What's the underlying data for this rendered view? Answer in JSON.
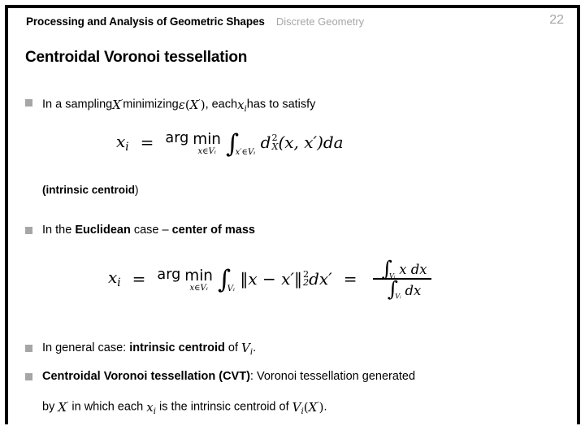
{
  "header": {
    "title": "Processing and Analysis of Geometric Shapes",
    "subtitle": "Discrete Geometry",
    "page_number": "22",
    "subtitle_color": "#a6a6a6",
    "page_color": "#a6a6a6"
  },
  "slide": {
    "title": "Centroidal Voronoi tessellation",
    "bullet_color": "#a6a6a6",
    "background": "#ffffff",
    "frame_color": "#000000"
  },
  "bullets": [
    {
      "id": "bullet-sampling",
      "parts": [
        {
          "text": "In a sampling ",
          "style": "normal"
        },
        {
          "text": "X′",
          "style": "math"
        },
        {
          "text": " minimizing ",
          "style": "normal"
        },
        {
          "text": "ε(X′)",
          "style": "math"
        },
        {
          "text": ", each ",
          "style": "normal"
        },
        {
          "text": "xᵢ",
          "style": "math"
        },
        {
          "text": " has to satisfy",
          "style": "normal"
        }
      ]
    },
    {
      "id": "bullet-euclidean",
      "parts": [
        {
          "text": "In the ",
          "style": "normal"
        },
        {
          "text": "Euclidean",
          "style": "bold"
        },
        {
          "text": " case – ",
          "style": "normal"
        },
        {
          "text": "center of mass",
          "style": "bold"
        }
      ]
    },
    {
      "id": "bullet-general-case",
      "parts": [
        {
          "text": "In general case: ",
          "style": "normal"
        },
        {
          "text": "intrinsic centroid",
          "style": "bold"
        },
        {
          "text": " of ",
          "style": "normal"
        },
        {
          "text": "Vᵢ",
          "style": "math"
        },
        {
          "text": ".",
          "style": "normal"
        }
      ]
    },
    {
      "id": "bullet-cvt",
      "parts": [
        {
          "text": "Centroidal Voronoi tessellation (CVT)",
          "style": "bold"
        },
        {
          "text": ": Voronoi tessellation generated",
          "style": "normal"
        }
      ]
    }
  ],
  "labels": {
    "intrinsic_centroid_bold": "(intrinsic centroid",
    "intrinsic_centroid_close": ")",
    "cvt_cont_by": "by ",
    "cvt_cont_inwhich": " in which each ",
    "cvt_cont_is": " is the intrinsic centroid of ",
    "cvt_cont_period": "."
  },
  "bullet1_text": {
    "t1": "In a sampling",
    "t2": "minimizing",
    "t3": ", each",
    "t4": "has to satisfy",
    "m1_X": "X",
    "m1_prime": "′",
    "m2_eps": "ε",
    "m2_open": "(",
    "m2_X": "X",
    "m2_prime": "′",
    "m2_close": ")",
    "m3_x": "x",
    "m3_sub": "i"
  },
  "bullet2_text": {
    "t1": "In the ",
    "t2": "Euclidean",
    "t3": " case – ",
    "t4": "center of mass"
  },
  "bullet3_text": {
    "t1": "In general case: ",
    "t2": "intrinsic centroid",
    "t3": " of ",
    "m_V": "V",
    "m_sub": "i",
    "t4": "."
  },
  "bullet4_text": {
    "t1": "Centroidal Voronoi tessellation (CVT)",
    "t2": ": Voronoi tessellation generated"
  },
  "cont_text": {
    "t1": "by ",
    "m1_X": "X",
    "m1_prime": "′",
    "t2": " in which each ",
    "m2_x": "x",
    "m2_sub": "i",
    "t3": " is the intrinsic centroid of ",
    "m3_V": "V",
    "m3_sub": "i",
    "m3_open": "(",
    "m3_X": "X",
    "m3_prime": "′",
    "m3_close": ")",
    "t4": "."
  },
  "equations": {
    "eq1": {
      "lhs_x": "x",
      "lhs_sub": "i",
      "equals": "=",
      "arg": "arg",
      "min": "min",
      "min_sub": "x∈Vᵢ",
      "int_sign": "∫",
      "int_sub": "x′∈Vᵢ",
      "integrand_d": "d",
      "integrand_sup": "2",
      "integrand_sub": "X",
      "integrand_args": "(x, x′)",
      "measure": "da"
    },
    "eq2": {
      "lhs_x": "x",
      "lhs_sub": "i",
      "equals": "=",
      "arg": "arg",
      "min": "min",
      "min_sub": "x∈Vᵢ",
      "int_sign": "∫",
      "int_sub": "Vᵢ",
      "norm_open": "‖",
      "norm_body": "x − x′",
      "norm_close": "‖",
      "norm_sup": "2",
      "norm_sub": "2",
      "measure": "dx′",
      "equals2": "=",
      "frac_num_int": "∫",
      "frac_num_sub": "Vᵢ",
      "frac_num_body": "x dx",
      "frac_den_int": "∫",
      "frac_den_sub": "Vᵢ",
      "frac_den_body": "dx"
    }
  },
  "caption": {
    "bold_part": "(intrinsic centroid",
    "light_part": ")"
  }
}
